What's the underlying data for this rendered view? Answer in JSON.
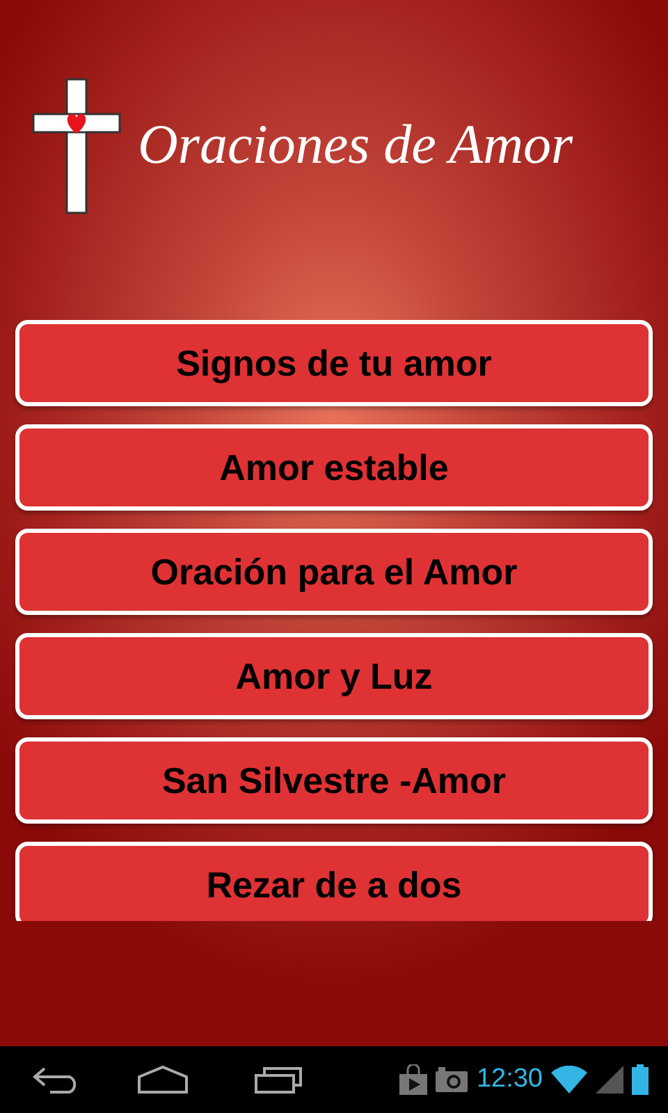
{
  "app": {
    "title": "Oraciones de Amor"
  },
  "buttons": [
    {
      "label": "Signos de tu amor"
    },
    {
      "label": "Amor estable"
    },
    {
      "label": "Oración para el Amor"
    },
    {
      "label": "Amor y Luz"
    },
    {
      "label": "San Silvestre -Amor"
    },
    {
      "label": "Rezar de a dos"
    }
  ],
  "status_bar": {
    "time": "12:30"
  }
}
